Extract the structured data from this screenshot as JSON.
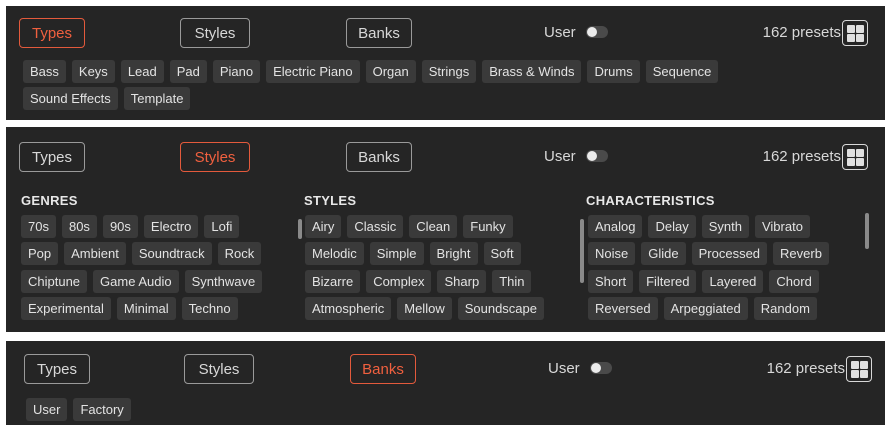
{
  "tabs": {
    "types": "Types",
    "styles": "Styles",
    "banks": "Banks"
  },
  "user_label": "User",
  "preset_count": "162 presets",
  "colors": {
    "accent": "#e35a3c",
    "panel_bg": "#252525",
    "tag_bg": "#3a3a3a"
  },
  "icons": {
    "grid": "grid-view-icon",
    "toggle": "user-toggle"
  },
  "panel1": {
    "active_tab": "Types",
    "types": [
      "Bass",
      "Keys",
      "Lead",
      "Pad",
      "Piano",
      "Electric Piano",
      "Organ",
      "Strings",
      "Brass & Winds",
      "Drums",
      "Sequence",
      "Sound Effects",
      "Template"
    ]
  },
  "panel2": {
    "active_tab": "Styles",
    "genres_title": "GENRES",
    "styles_title": "STYLES",
    "characteristics_title": "CHARACTERISTICS",
    "genres": [
      "70s",
      "80s",
      "90s",
      "Electro",
      "Lofi",
      "Pop",
      "Ambient",
      "Soundtrack",
      "Rock",
      "Chiptune",
      "Game Audio",
      "Synthwave",
      "Experimental",
      "Minimal",
      "Techno"
    ],
    "styles": [
      "Airy",
      "Classic",
      "Clean",
      "Funky",
      "Melodic",
      "Simple",
      "Bright",
      "Soft",
      "Bizarre",
      "Complex",
      "Sharp",
      "Thin",
      "Atmospheric",
      "Mellow",
      "Soundscape"
    ],
    "characteristics": [
      "Analog",
      "Delay",
      "Synth",
      "Vibrato",
      "Noise",
      "Glide",
      "Processed",
      "Reverb",
      "Short",
      "Filtered",
      "Layered",
      "Chord",
      "Reversed",
      "Arpeggiated",
      "Random"
    ]
  },
  "panel3": {
    "active_tab": "Banks",
    "banks": [
      "User",
      "Factory"
    ]
  }
}
